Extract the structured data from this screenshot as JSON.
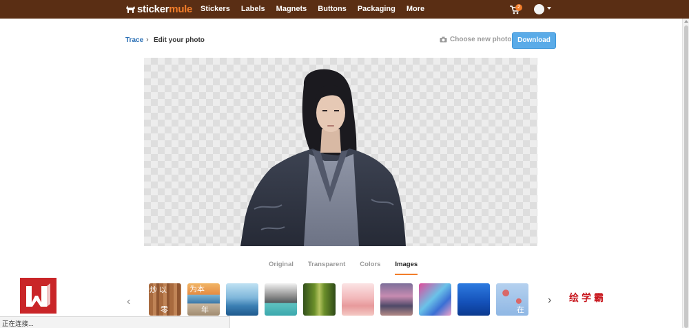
{
  "navbar": {
    "logo_part1": "sticker",
    "logo_part2": "mule",
    "links": [
      "Stickers",
      "Labels",
      "Magnets",
      "Buttons",
      "Packaging",
      "More"
    ],
    "cart_count": "2",
    "colors": {
      "bar": "#5a2e14",
      "accent": "#f27d2a"
    }
  },
  "breadcrumb": {
    "link": "Trace",
    "separator": "›",
    "current": "Edit your photo"
  },
  "actions": {
    "choose_photo": "Choose new photo",
    "download": "Download"
  },
  "tabs": [
    {
      "label": "Original",
      "active": false
    },
    {
      "label": "Transparent",
      "active": false
    },
    {
      "label": "Colors",
      "active": false
    },
    {
      "label": "Images",
      "active": true
    }
  ],
  "thumbnails": [
    {
      "name": "wood-texture",
      "overlay_top": "炒 以",
      "overlay_bottom": "零"
    },
    {
      "name": "pier-sunset",
      "overlay_top": "为本",
      "overlay_bottom": "年"
    },
    {
      "name": "blue-mountains",
      "overlay_top": "",
      "overlay_bottom": ""
    },
    {
      "name": "mountain-lake",
      "overlay_top": "",
      "overlay_bottom": ""
    },
    {
      "name": "green-forest",
      "overlay_top": "",
      "overlay_bottom": ""
    },
    {
      "name": "pink-hills",
      "overlay_top": "",
      "overlay_bottom": ""
    },
    {
      "name": "city-street",
      "overlay_top": "",
      "overlay_bottom": ""
    },
    {
      "name": "watercolor",
      "overlay_top": "",
      "overlay_bottom": ""
    },
    {
      "name": "underwater",
      "overlay_top": "",
      "overlay_bottom": ""
    },
    {
      "name": "floral-pattern",
      "overlay_top": "",
      "overlay_bottom": "在"
    }
  ],
  "overlays": {
    "watermark": "绘学霸",
    "status_text": "正在连接..."
  }
}
